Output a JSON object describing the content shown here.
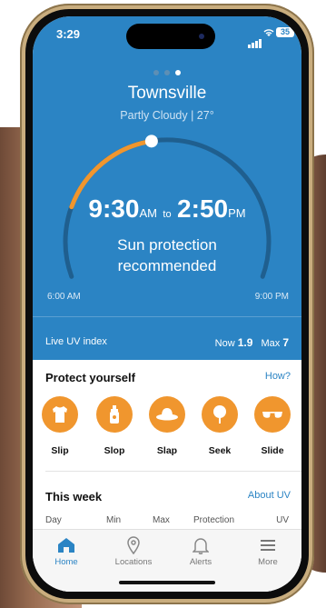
{
  "status": {
    "time": "3:29",
    "battery": "35"
  },
  "pager": {
    "count": 3,
    "active": 2
  },
  "location": {
    "city": "Townsville",
    "weather": "Partly Cloudy | 27°"
  },
  "sun_protection": {
    "start_time": "9:30",
    "start_suffix": "AM",
    "connector": "to",
    "end_time": "2:50",
    "end_suffix": "PM",
    "message_line1": "Sun protection",
    "message_line2": "recommended",
    "day_start": "6:00 AM",
    "day_end": "9:00 PM",
    "progress": 0.46
  },
  "uv": {
    "label": "Live UV index",
    "now_label": "Now",
    "now_value": "1.9",
    "max_label": "Max",
    "max_value": "7"
  },
  "protect": {
    "title": "Protect yourself",
    "link": "How?",
    "items": [
      {
        "label": "Slip",
        "icon": "shirt-icon"
      },
      {
        "label": "Slop",
        "icon": "sunscreen-icon"
      },
      {
        "label": "Slap",
        "icon": "hat-icon"
      },
      {
        "label": "Seek",
        "icon": "shade-tree-icon"
      },
      {
        "label": "Slide",
        "icon": "sunglasses-icon"
      }
    ]
  },
  "week": {
    "title": "This week",
    "link": "About UV",
    "columns": [
      "Day",
      "Min",
      "Max",
      "Protection",
      "UV"
    ]
  },
  "tabbar": {
    "items": [
      {
        "label": "Home",
        "icon": "home-icon",
        "active": true
      },
      {
        "label": "Locations",
        "icon": "location-pin-icon",
        "active": false
      },
      {
        "label": "Alerts",
        "icon": "bell-icon",
        "active": false
      },
      {
        "label": "More",
        "icon": "menu-icon",
        "active": false
      }
    ]
  },
  "colors": {
    "primary": "#2b84c4",
    "accent": "#f0962e",
    "arc_track": "#1f5f8f"
  }
}
